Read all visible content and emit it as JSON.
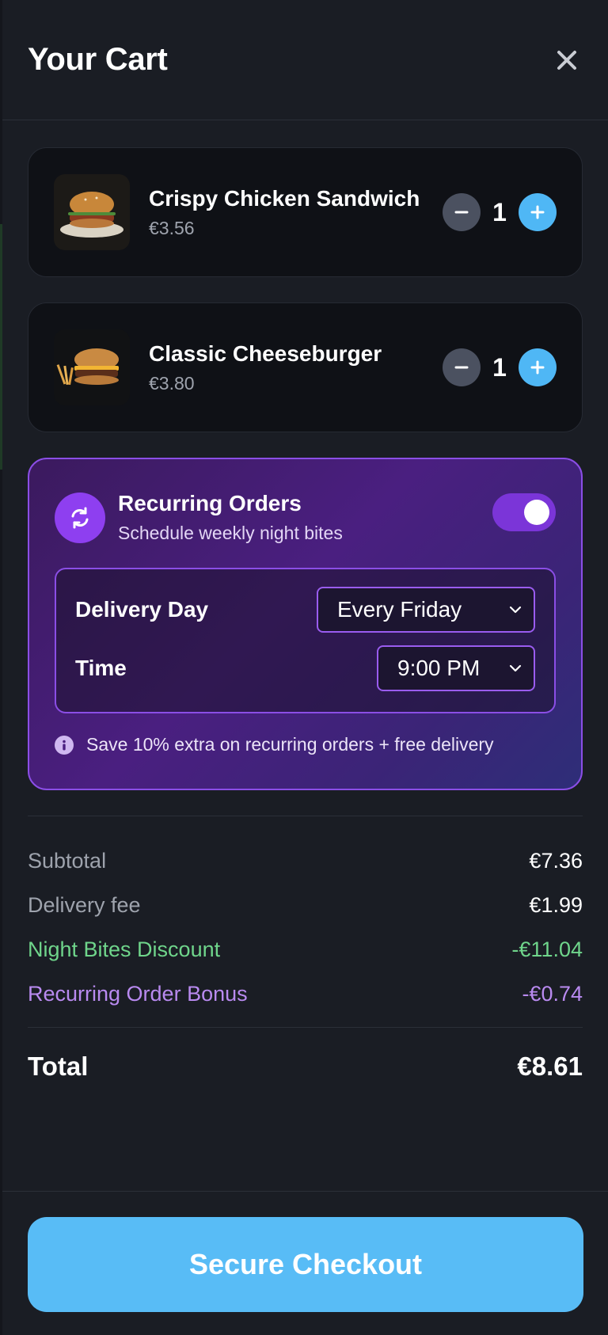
{
  "cart": {
    "title": "Your Cart",
    "close_icon": "close-icon"
  },
  "items": [
    {
      "name": "Crispy Chicken Sandwich",
      "price": "€3.56",
      "quantity": "1",
      "image": "crispy-chicken-sandwich-photo"
    },
    {
      "name": "Classic Cheeseburger",
      "price": "€3.80",
      "quantity": "1",
      "image": "classic-cheeseburger-photo"
    }
  ],
  "recurring": {
    "title": "Recurring Orders",
    "subtitle": "Schedule weekly night bites",
    "enabled": true,
    "icon": "refresh-icon",
    "delivery_day_label": "Delivery Day",
    "delivery_day_value": "Every Friday",
    "time_label": "Time",
    "time_value": "9:00 PM",
    "promo": "Save 10% extra on recurring orders + free delivery",
    "promo_icon": "info-icon"
  },
  "summary": {
    "subtotal_label": "Subtotal",
    "subtotal": "€7.36",
    "delivery_label": "Delivery fee",
    "delivery": "€1.99",
    "discount_label": "Night Bites Discount",
    "discount": "-€11.04",
    "bonus_label": "Recurring Order Bonus",
    "bonus": "-€0.74",
    "total_label": "Total",
    "total": "€8.61"
  },
  "checkout": {
    "label": "Secure Checkout"
  },
  "colors": {
    "accent_blue": "#58bcf6",
    "accent_purple": "#8e3ff0",
    "discount_green": "#6fd58b",
    "bonus_purple": "#b98af0",
    "panel_bg": "#1a1d24"
  }
}
